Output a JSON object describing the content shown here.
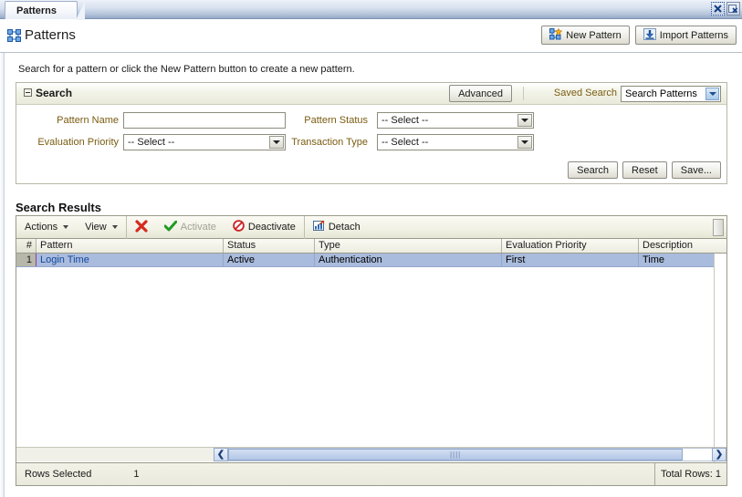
{
  "window": {
    "tab_label": "Patterns",
    "close_icon": "close-icon",
    "restore_icon": "restore-window-icon"
  },
  "header": {
    "title": "Patterns",
    "title_icon": "pattern-nodes-icon",
    "buttons": [
      {
        "label": "New Pattern",
        "icon": "new-pattern-icon"
      },
      {
        "label": "Import Patterns",
        "icon": "import-download-icon"
      }
    ]
  },
  "instruction": "Search for a pattern or click the New Pattern button to create a new pattern.",
  "search": {
    "panel_title": "Search",
    "collapse_icon": "collapse-minus-icon",
    "advanced_label": "Advanced",
    "saved_search_label": "Saved Search",
    "saved_search_value": "Search Patterns",
    "fields": {
      "pattern_name_label": "Pattern Name",
      "pattern_name_value": "",
      "evaluation_priority_label": "Evaluation Priority",
      "evaluation_priority_value": "-- Select --",
      "pattern_status_label": "Pattern Status",
      "pattern_status_value": "-- Select --",
      "transaction_type_label": "Transaction Type",
      "transaction_type_value": "-- Select --"
    },
    "actions": [
      {
        "label": "Search"
      },
      {
        "label": "Reset"
      },
      {
        "label": "Save..."
      }
    ]
  },
  "results": {
    "title": "Search Results",
    "toolbar": [
      {
        "label": "Actions",
        "icon": "chevron-down-icon",
        "type": "menu",
        "disabled": false
      },
      {
        "label": "View",
        "icon": "chevron-down-icon",
        "type": "menu",
        "disabled": false
      },
      {
        "label": "",
        "icon": "delete-x-icon",
        "type": "icon",
        "disabled": false
      },
      {
        "label": "Activate",
        "icon": "green-check-icon",
        "type": "button",
        "disabled": true
      },
      {
        "label": "Deactivate",
        "icon": "no-entry-icon",
        "type": "button",
        "disabled": false
      },
      {
        "label": "Detach",
        "icon": "detach-icon",
        "type": "button",
        "disabled": false
      }
    ],
    "columns": [
      "#",
      "Pattern",
      "Status",
      "Type",
      "Evaluation Priority",
      "Description"
    ],
    "rows": [
      {
        "num": "1",
        "pattern": "Login Time",
        "status": "Active",
        "type": "Authentication",
        "evaluation_priority": "First",
        "description": "Time"
      }
    ],
    "scroll_left_icon": "scroll-left-icon",
    "scroll_right_icon": "scroll-right-icon",
    "status_bar": {
      "rows_selected_label": "Rows Selected",
      "rows_selected_value": "1",
      "total_rows": "Total Rows: 1"
    }
  },
  "colors": {
    "label_brown": "#7a5c10",
    "link_blue": "#12489e",
    "row_selected": "#aabcdd",
    "panel_bg": "#ecece0"
  }
}
